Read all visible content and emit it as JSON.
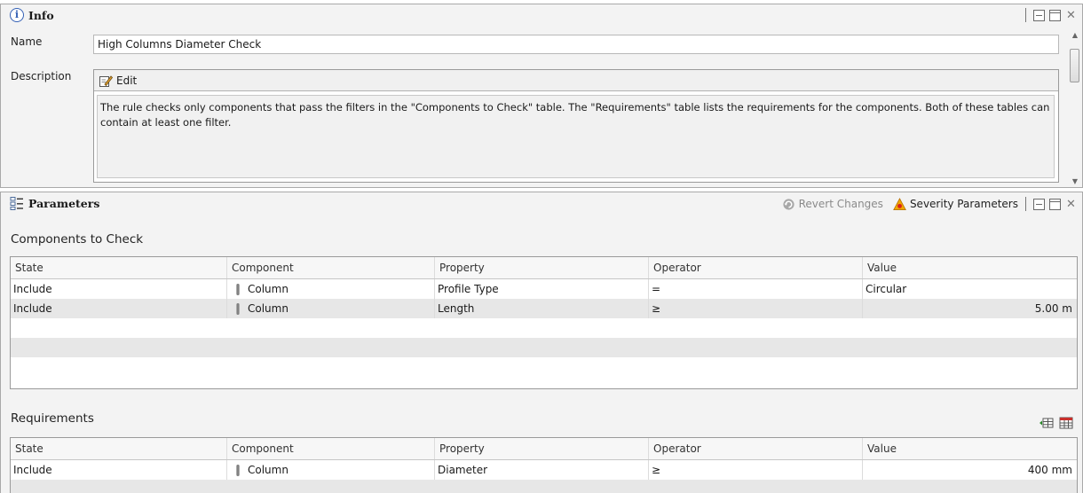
{
  "info": {
    "title": "Info",
    "name_label": "Name",
    "name_value": "High Columns Diameter Check",
    "description_label": "Description",
    "edit_label": "Edit",
    "description_text": "The rule checks only components that pass the filters in the \"Components to Check\" table. The \"Requirements\" table lists the requirements for the components. Both of these tables can contain at least one filter."
  },
  "parameters": {
    "title": "Parameters",
    "revert_label": "Revert Changes",
    "severity_label": "Severity Parameters",
    "columns": [
      "State",
      "Component",
      "Property",
      "Operator",
      "Value"
    ],
    "components_to_check": {
      "label": "Components to Check",
      "rows": [
        {
          "state": "Include",
          "component": "Column",
          "property": "Profile Type",
          "operator": "=",
          "value": "Circular"
        },
        {
          "state": "Include",
          "component": "Column",
          "property": "Length",
          "operator": "≥",
          "value": "5.00 m"
        }
      ]
    },
    "requirements": {
      "label": "Requirements",
      "rows": [
        {
          "state": "Include",
          "component": "Column",
          "property": "Diameter",
          "operator": "≥",
          "value": "400 mm"
        }
      ]
    }
  },
  "icons": [
    "info-icon",
    "minimize-icon",
    "maximize-icon",
    "close-icon",
    "edit-icon",
    "parameters-icon",
    "revert-icon",
    "severity-warning-icon",
    "add-row-icon",
    "table-settings-icon",
    "column-icon"
  ],
  "colors": {
    "accent": "#3561b5",
    "warning": "#e8a400",
    "selected_row": "#e7e7e7"
  }
}
